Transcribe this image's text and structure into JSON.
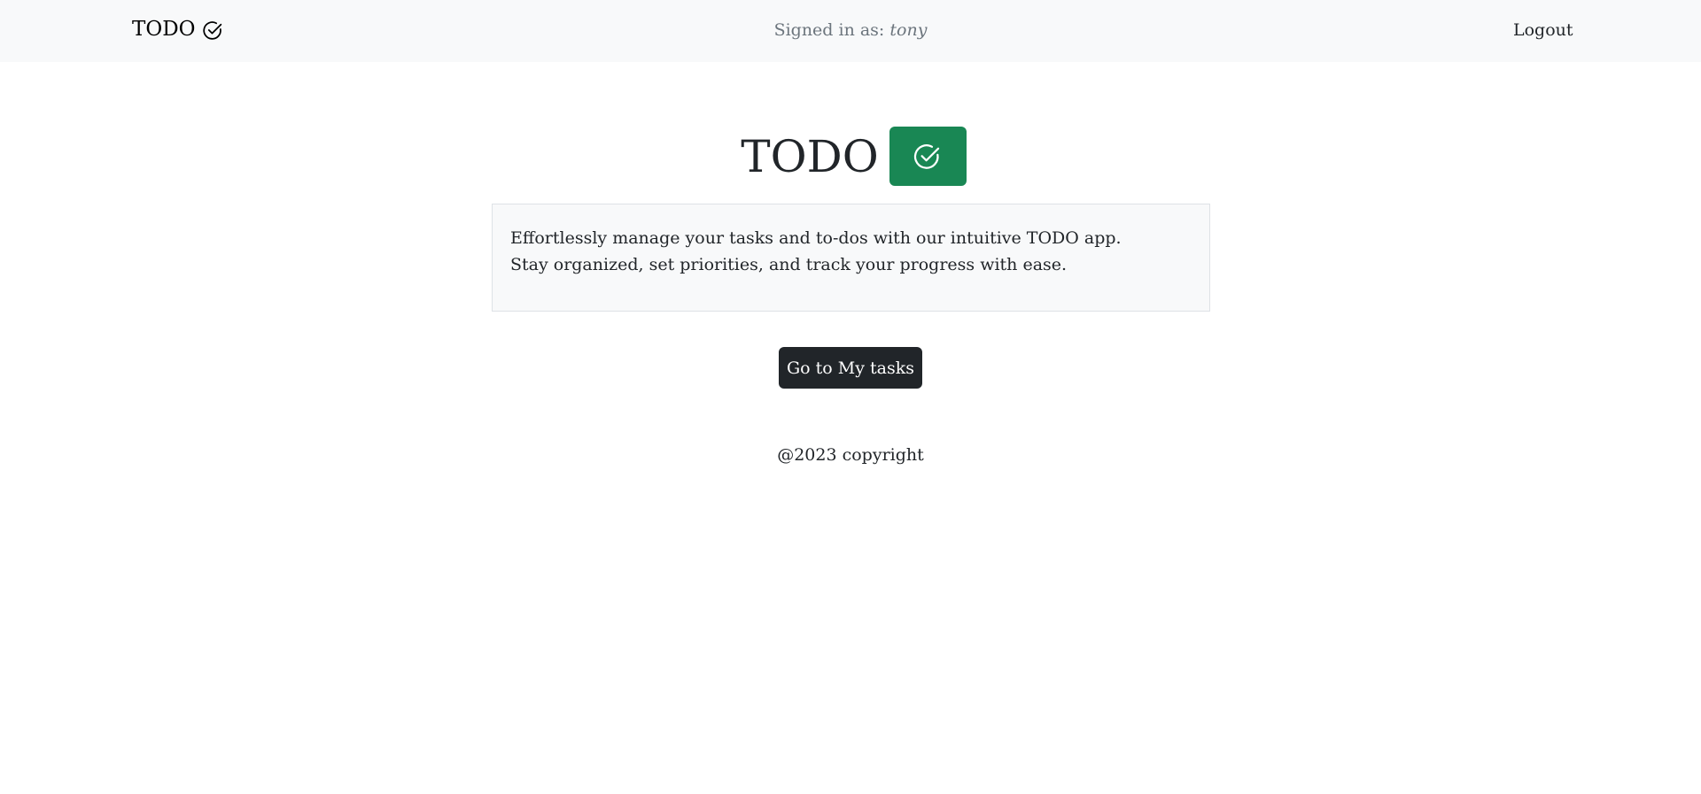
{
  "navbar": {
    "brand_label": "TODO",
    "brand_icon": "check-circle-icon",
    "signed_in_prefix": "Signed in as:",
    "signed_in_user": "tony",
    "logout_label": "Logout"
  },
  "hero": {
    "title": "TODO",
    "badge_icon": "check-circle-icon",
    "badge_color": "#198754"
  },
  "description": {
    "text": "Effortlessly manage your tasks and to-dos with our intuitive TODO app. Stay organized, set priorities, and track your progress with ease."
  },
  "cta": {
    "label": "Go to My tasks",
    "color": "#212529"
  },
  "footer": {
    "text": "@2023 copyright"
  }
}
